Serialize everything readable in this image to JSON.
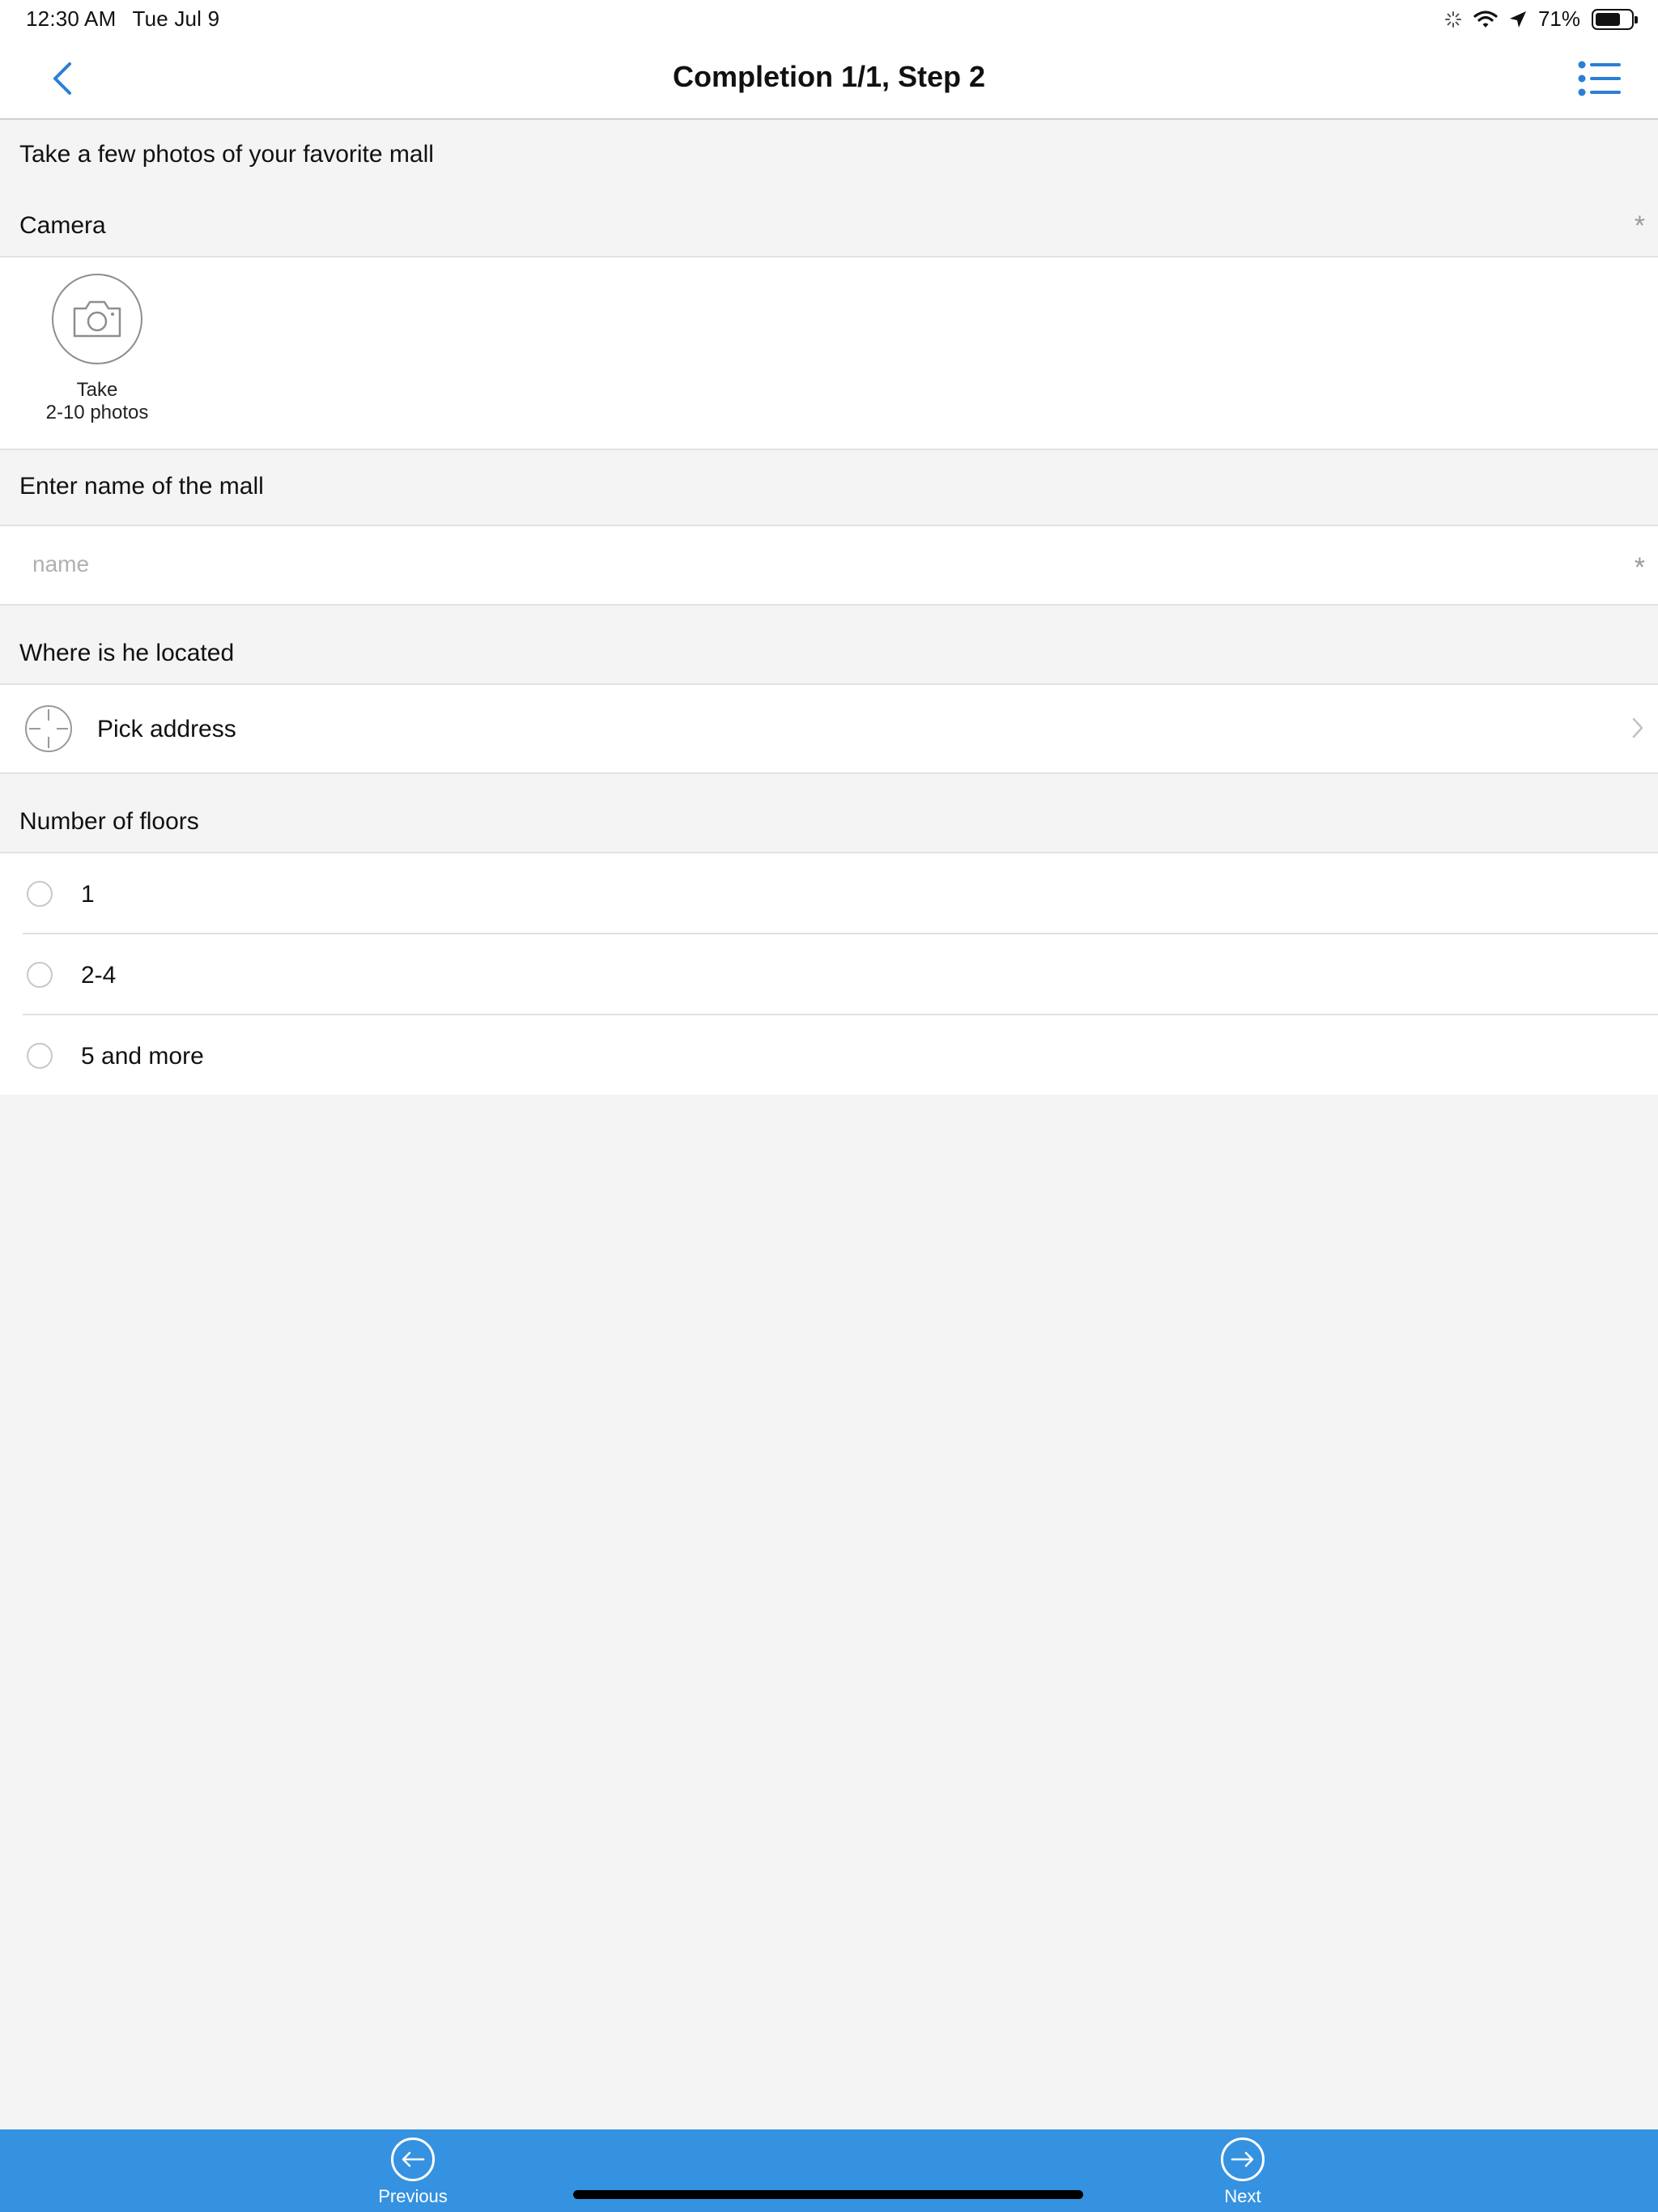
{
  "status_bar": {
    "time": "12:30 AM",
    "date": "Tue Jul 9",
    "battery_percent": "71%",
    "battery_level": 0.71,
    "icons": [
      "activity-spinner-icon",
      "wifi-icon",
      "location-arrow-icon",
      "battery-icon"
    ]
  },
  "nav": {
    "title": "Completion 1/1, Step 2",
    "back_icon": "chevron-left-icon",
    "menu_icon": "list-icon",
    "accent_color": "#2a7fd4"
  },
  "form": {
    "intro": "Take a few photos of your favorite mall",
    "camera": {
      "header": "Camera",
      "required_mark": "*",
      "caption_line1": "Take",
      "caption_line2": "2-10 photos"
    },
    "mall_name": {
      "header": "Enter name of the mall",
      "placeholder": "name",
      "value": "",
      "required_mark": "*"
    },
    "location": {
      "header": "Where is he located",
      "action_label": "Pick address"
    },
    "floors": {
      "header": "Number of floors",
      "options": [
        {
          "label": "1",
          "selected": false
        },
        {
          "label": "2-4",
          "selected": false
        },
        {
          "label": "5 and more",
          "selected": false
        }
      ]
    }
  },
  "toolbar": {
    "background": "#3592e0",
    "previous_label": "Previous",
    "next_label": "Next"
  }
}
